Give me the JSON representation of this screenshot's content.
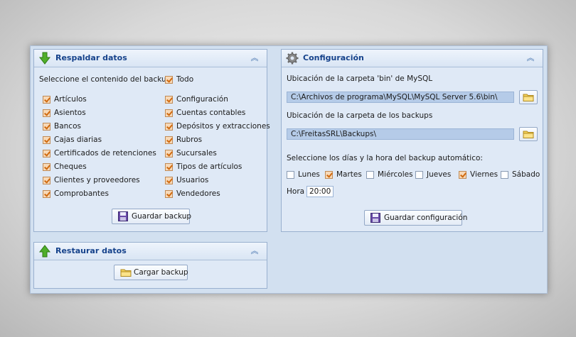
{
  "backup_panel": {
    "title": "Respaldar datos",
    "select_label": "Seleccione el contenido del backup:",
    "todo_label": "Todo",
    "todo_checked": true,
    "items_left": [
      {
        "label": "Artículos",
        "checked": true
      },
      {
        "label": "Asientos",
        "checked": true
      },
      {
        "label": "Bancos",
        "checked": true
      },
      {
        "label": "Cajas diarias",
        "checked": true
      },
      {
        "label": "Certificados de retenciones",
        "checked": true
      },
      {
        "label": "Cheques",
        "checked": true
      },
      {
        "label": "Clientes y proveedores",
        "checked": true
      },
      {
        "label": "Comprobantes",
        "checked": true
      }
    ],
    "items_right": [
      {
        "label": "Configuración",
        "checked": true
      },
      {
        "label": "Cuentas contables",
        "checked": true
      },
      {
        "label": "Depósitos y extracciones",
        "checked": true
      },
      {
        "label": "Rubros",
        "checked": true
      },
      {
        "label": "Sucursales",
        "checked": true
      },
      {
        "label": "Tipos de artículos",
        "checked": true
      },
      {
        "label": "Usuarios",
        "checked": true
      },
      {
        "label": "Vendedores",
        "checked": true
      }
    ],
    "save_button": "Guardar backup"
  },
  "restore_panel": {
    "title": "Restaurar datos",
    "load_button": "Cargar backup"
  },
  "config_panel": {
    "title": "Configuración",
    "mysql_label": "Ubicación de la carpeta 'bin' de MySQL",
    "mysql_path": "C:\\Archivos de programa\\MySQL\\MySQL Server 5.6\\bin\\",
    "backups_label": "Ubicación de la carpeta de los backups",
    "backups_path": "C:\\FreitasSRL\\Backups\\",
    "schedule_label": "Seleccione los días y la hora del backup automático:",
    "days": [
      {
        "label": "Lunes",
        "checked": false
      },
      {
        "label": "Martes",
        "checked": true
      },
      {
        "label": "Miércoles",
        "checked": false
      },
      {
        "label": "Jueves",
        "checked": false
      },
      {
        "label": "Viernes",
        "checked": true
      },
      {
        "label": "Sábado",
        "checked": false
      }
    ],
    "hour_label": "Hora",
    "hour_value": "20:00",
    "save_button": "Guardar configuración"
  },
  "colors": {
    "panel_title": "#15428b",
    "check_accent": "#d06a10",
    "path_field": "#b5cbe8"
  },
  "icons": {
    "backup_header": "green-down-arrow-icon",
    "restore_header": "green-up-arrow-icon",
    "config_header": "gear-icon",
    "collapse": "double-chevron-up-icon",
    "save": "floppy-disk-icon",
    "folder": "folder-icon"
  }
}
